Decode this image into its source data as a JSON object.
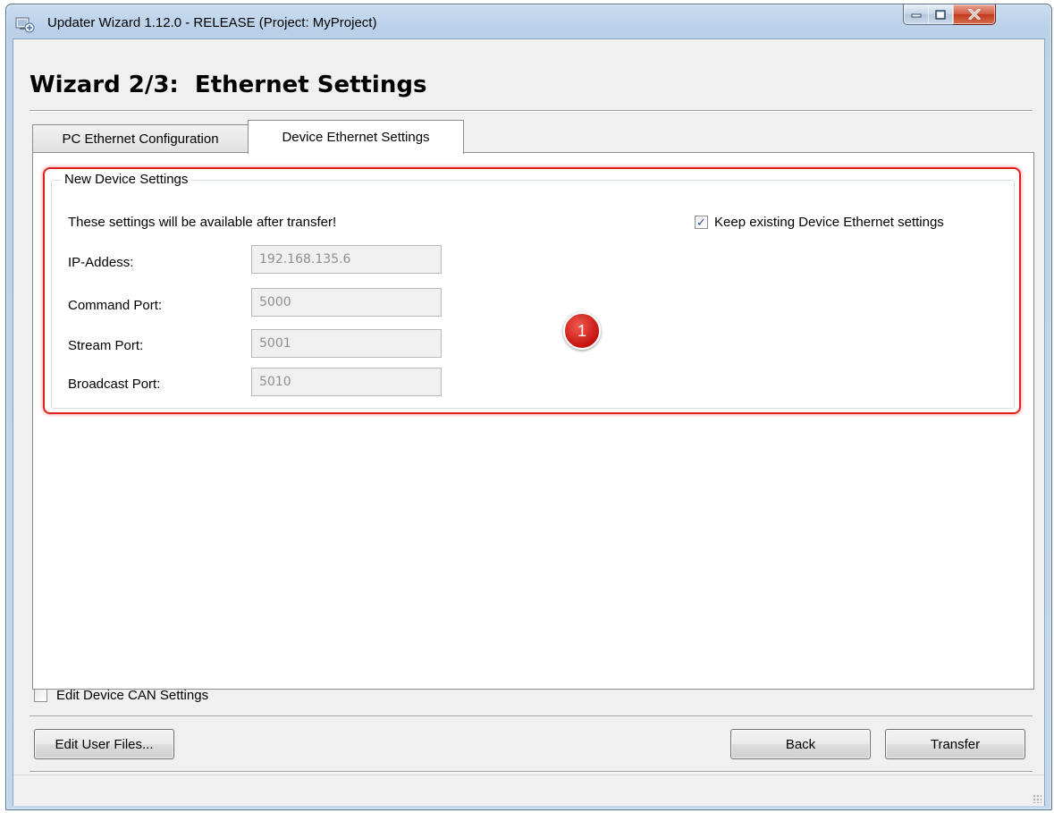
{
  "window": {
    "title": "Updater Wizard 1.12.0 - RELEASE (Project: MyProject)",
    "controls": {
      "minimize": "minimize-icon",
      "maximize": "maximize-icon",
      "close": "close-icon"
    }
  },
  "heading": "Wizard 2/3:  Ethernet Settings",
  "tabs": [
    {
      "label": "PC Ethernet Configuration",
      "active": false
    },
    {
      "label": "Device Ethernet Settings",
      "active": true
    }
  ],
  "group": {
    "title": "New Device Settings",
    "note": "These settings will be available after transfer!",
    "keep_existing": {
      "label": "Keep existing Device Ethernet settings",
      "checked": true
    },
    "fields": {
      "ip": {
        "label": "IP-Addess:",
        "value": "192.168.135.6"
      },
      "command_port": {
        "label": "Command  Port:",
        "value": "5000"
      },
      "stream_port": {
        "label": "Stream Port:",
        "value": "5001"
      },
      "broadcast_port": {
        "label": "Broadcast Port:",
        "value": "5010"
      }
    },
    "callout_badge": "1",
    "highlight_color": "#e0201c"
  },
  "edit_can": {
    "label": "Edit Device CAN Settings",
    "checked": false
  },
  "buttons": {
    "edit_user_files": "Edit User Files...",
    "back": "Back",
    "transfer": "Transfer"
  },
  "colors": {
    "title_bar": "#c3d8ee",
    "dialog_bg": "#f0f0f0",
    "close_button": "#c13a1c"
  }
}
